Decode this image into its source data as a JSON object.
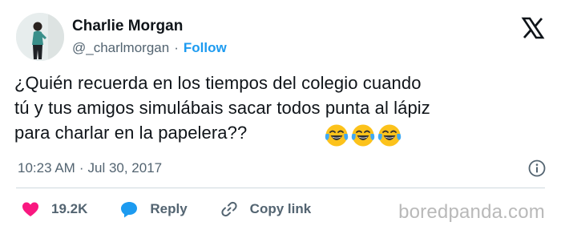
{
  "tweet": {
    "author": {
      "display_name": "Charlie Morgan",
      "handle": "@_charlmorgan",
      "separator": "·",
      "follow_label": "Follow"
    },
    "platform_icon": "x-logo-icon",
    "text_lines": [
      "¿Quién recuerda en los tiempos del colegio cuando",
      "tú y tus amigos simulábais sacar todos punta al lápiz",
      "para charlar en la papelera??"
    ],
    "emojis": [
      "face-with-tears-of-joy-icon",
      "face-with-tears-of-joy-icon",
      "face-with-tears-of-joy-icon"
    ],
    "time": "10:23 AM",
    "date_separator": "·",
    "date": "Jul 30, 2017",
    "info_icon": "info-icon",
    "actions": {
      "likes": {
        "icon": "heart-icon",
        "label": "19.2K",
        "color": "#f91880"
      },
      "reply": {
        "icon": "reply-bubble-icon",
        "label": "Reply",
        "color": "#1d9bf0"
      },
      "copy": {
        "icon": "link-icon",
        "label": "Copy link"
      }
    }
  },
  "watermark": "boredpanda.com",
  "colors": {
    "text": "#0f1419",
    "secondary": "#536471",
    "accent": "#1d9bf0",
    "like": "#f91880"
  }
}
